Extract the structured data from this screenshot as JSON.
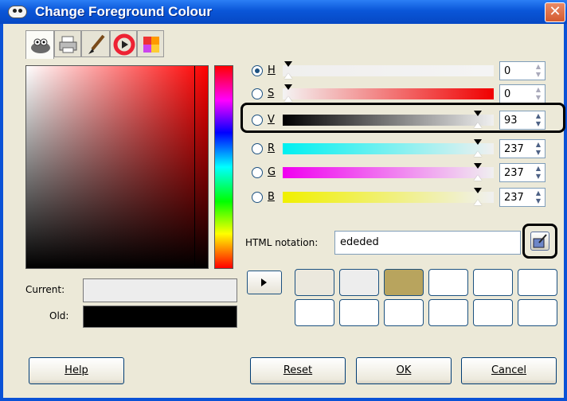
{
  "window": {
    "title": "Change Foreground Colour",
    "close_glyph": "✕"
  },
  "tabs": [
    {
      "name": "gimp-wilber-icon",
      "active": true
    },
    {
      "name": "printer-icon",
      "active": false
    },
    {
      "name": "paint-brush-icon",
      "active": false
    },
    {
      "name": "color-wheel-icon",
      "active": false
    },
    {
      "name": "palette-icon",
      "active": false
    }
  ],
  "preview": {
    "current_label": "Current:",
    "old_label": "Old:",
    "current_color": "#ededed",
    "old_color": "#000000"
  },
  "channels": [
    {
      "key": "H",
      "value": "0",
      "selected": true,
      "spin_disabled": true
    },
    {
      "key": "S",
      "value": "0",
      "selected": false,
      "spin_disabled": true
    },
    {
      "key": "V",
      "value": "93",
      "selected": false,
      "spin_disabled": false
    },
    {
      "key": "R",
      "value": "237",
      "selected": false,
      "spin_disabled": false
    },
    {
      "key": "G",
      "value": "237",
      "selected": false,
      "spin_disabled": false
    },
    {
      "key": "B",
      "value": "237",
      "selected": false,
      "spin_disabled": false
    }
  ],
  "html_notation": {
    "label": "HTML notation:",
    "value": "ededed"
  },
  "history": {
    "row1": [
      "#ebe8dd",
      "#ededed",
      "#b8a45e",
      "#ffffff",
      "#ffffff",
      "#ffffff"
    ],
    "row2": [
      "#ffffff",
      "#ffffff",
      "#ffffff",
      "#ffffff",
      "#ffffff",
      "#ffffff"
    ]
  },
  "buttons": {
    "help": "Help",
    "reset": "Reset",
    "ok": "OK",
    "cancel": "Cancel"
  }
}
